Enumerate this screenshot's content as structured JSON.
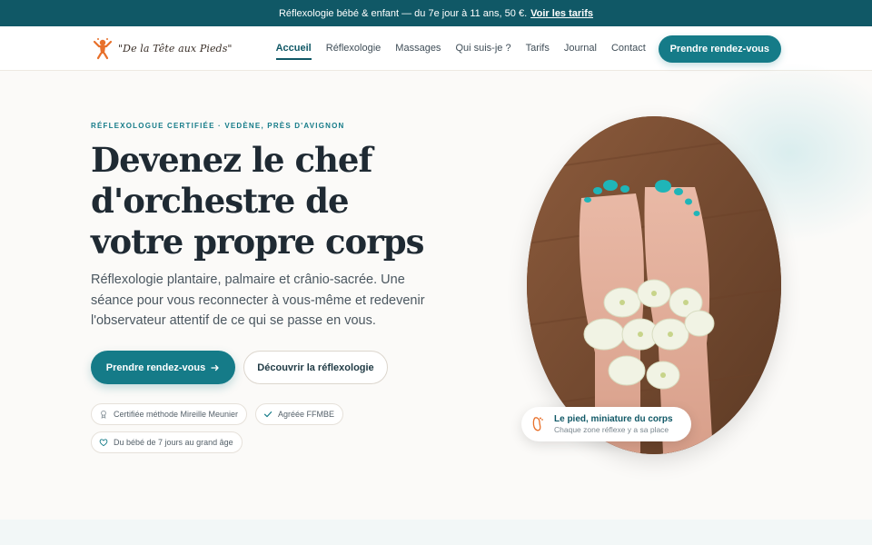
{
  "announcement": {
    "text": "Réflexologie bébé & enfant — du 7e jour à 11 ans, 50 €.",
    "link": "Voir les tarifs"
  },
  "brand": {
    "name": "\"De la Tête aux Pieds\"",
    "color": "#e8702a"
  },
  "nav": {
    "items": [
      {
        "label": "Accueil",
        "active": true
      },
      {
        "label": "Réflexologie"
      },
      {
        "label": "Massages"
      },
      {
        "label": "Qui suis-je ?"
      },
      {
        "label": "Tarifs"
      },
      {
        "label": "Journal"
      },
      {
        "label": "Contact"
      }
    ],
    "cta": "Prendre rendez-vous"
  },
  "hero": {
    "eyebrow": "RÉFLEXOLOGUE CERTIFIÉE · VEDÈNE, PRÈS D'AVIGNON",
    "title_lines": [
      "Devenez le chef",
      "d'orchestre de",
      "votre propre corps"
    ],
    "lead": "Réflexologie plantaire, palmaire et crânio-sacrée. Une séance pour vous reconnecter à vous-même et redevenir l'observateur attentif de ce qui se passe en vous.",
    "primary_button": "Prendre rendez-vous",
    "secondary_button": "Découvrir la réflexologie",
    "badges": [
      {
        "icon": "award-icon",
        "label": "Certifiée méthode Mireille Meunier"
      },
      {
        "icon": "check-icon",
        "label": "Agréée FFMBE"
      },
      {
        "icon": "heart-icon",
        "label": "Du bébé de 7 jours au grand âge"
      }
    ],
    "image": {
      "description_icon": "feet-with-orchids-photo"
    },
    "caption": {
      "icon": "foot-icon",
      "title": "Le pied, miniature du corps",
      "subtitle": "Chaque zone réflexe y a sa place"
    }
  },
  "colors": {
    "primary": "#157b88",
    "dark_teal": "#105866",
    "accent_orange": "#e8702a",
    "background": "#fbfaf8"
  }
}
